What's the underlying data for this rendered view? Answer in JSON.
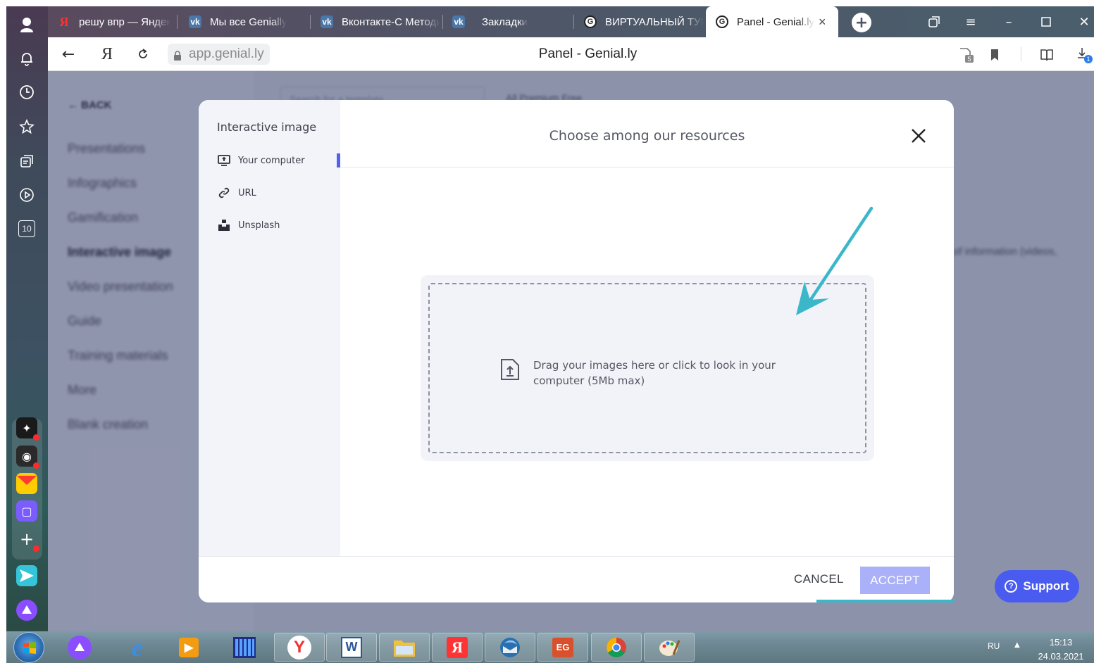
{
  "browser": {
    "tabs": [
      {
        "title": "решу впр — Яндекс",
        "icon": "yandex-icon"
      },
      {
        "title": "Мы все Genially",
        "icon": "vk-icon"
      },
      {
        "title": "Вконтакте-С Методи",
        "icon": "vk-icon"
      },
      {
        "title": "Закладки",
        "icon": "vk-icon"
      },
      {
        "title": "ВИРТУАЛЬНЫЙ ТУР",
        "icon": "genially-icon"
      },
      {
        "title": "Panel - Genial.ly",
        "icon": "genially-icon",
        "active": true
      }
    ],
    "new_tab_label": "+",
    "address": "app.genial.ly",
    "page_title": "Panel - Genial.ly",
    "yandex_letter": "Я",
    "side_rail_counter": "10",
    "badge_ad_count": "5",
    "badge_downloads": "1"
  },
  "page": {
    "back_label": "BACK",
    "nav_items": [
      "Presentations",
      "Infographics",
      "Gamification",
      "Interactive image",
      "Video presentation",
      "Guide",
      "Training materials",
      "More",
      "Blank creation"
    ],
    "active_nav": "Interactive image",
    "search_placeholder": "Search for a template",
    "filter_label": "All  Premium  Free",
    "right_text": "of information (videos,",
    "support_label": "Support"
  },
  "modal": {
    "side_title": "Interactive image",
    "side_items": [
      {
        "label": "Your computer",
        "icon": "monitor-upload-icon",
        "active": true
      },
      {
        "label": "URL",
        "icon": "link-icon"
      },
      {
        "label": "Unsplash",
        "icon": "unsplash-icon"
      }
    ],
    "title": "Choose among our resources",
    "drop_text": "Drag your images here or click to look in your computer (5Mb max)",
    "cancel_label": "CANCEL",
    "accept_label": "ACCEPT"
  },
  "taskbar": {
    "lang": "RU",
    "time": "15:13",
    "date": "24.03.2021"
  },
  "colors": {
    "accent": "#5061f0",
    "accept_disabled": "#aab1f8",
    "annotation": "#3bb7c9"
  }
}
